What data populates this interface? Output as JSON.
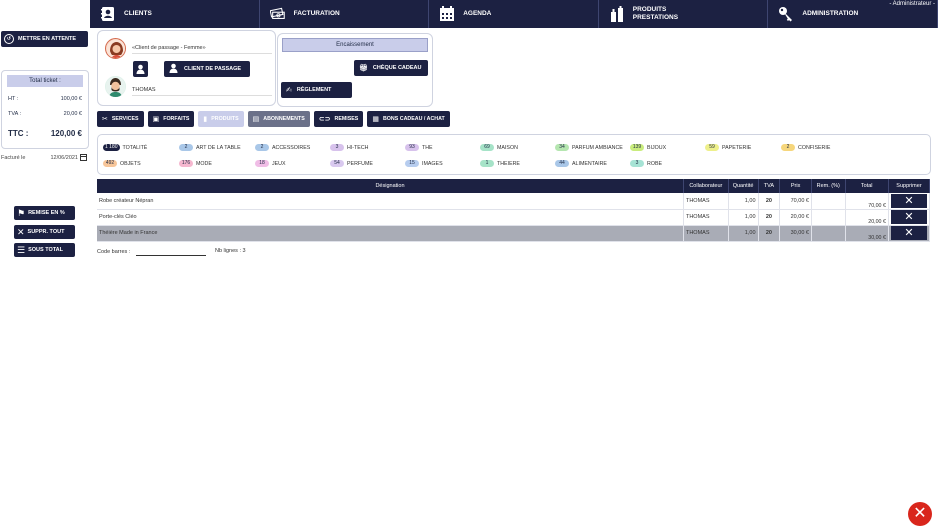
{
  "nav": {
    "items": [
      {
        "label": "CLIENTS",
        "icon": "address-book-icon"
      },
      {
        "label": "FACTURATION",
        "icon": "money-icon"
      },
      {
        "label": "AGENDA",
        "icon": "calendar-icon"
      },
      {
        "label": "PRODUITS\nPRESTATIONS",
        "line1": "PRODUITS",
        "line2": "PRESTATIONS",
        "icon": "bottles-icon"
      },
      {
        "label": "ADMINISTRATION",
        "icon": "key-icon"
      }
    ],
    "user": "- Administrateur -"
  },
  "left": {
    "wait_button": "METTRE EN ATTENTE",
    "ticket": {
      "title": "Total ticket :",
      "ht_label": "HT :",
      "ht_value": "100,00 €",
      "tva_label": "TVA :",
      "tva_value": "20,00 €",
      "ttc_label": "TTC :",
      "ttc_value": "120,00 €"
    },
    "invoice_label": "Facturé le",
    "invoice_date": "12/06/2021",
    "remise_button": "REMISE EN %",
    "suppr_button": "SUPPR. TOUT",
    "soustotal_button": "SOUS TOTAL"
  },
  "client": {
    "name": "«Client de passage - Femme»",
    "passage_button": "CLIENT DE PASSAGE",
    "collaborator": "THOMAS"
  },
  "encaissement": {
    "title": "Encaissement",
    "cheque_button": "CHÈQUE CADEAU",
    "reglement_button": "RÈGLEMENT"
  },
  "tabs": [
    {
      "label": "SERVICES",
      "style": "dark"
    },
    {
      "label": "FORFAITS",
      "style": "dark"
    },
    {
      "label": "PRODUITS",
      "style": "light"
    },
    {
      "label": "ABONNEMENTS",
      "style": "mid"
    },
    {
      "label": "REMISES",
      "style": "dark"
    },
    {
      "label": "BONS CADEAU / ACHAT",
      "style": "dark"
    }
  ],
  "filters": [
    {
      "count": "1 180",
      "label": "TOTALITÉ",
      "color": "#1c2142",
      "text": "#ffffff"
    },
    {
      "count": "2",
      "label": "ART DE LA TABLE",
      "color": "#a9c7e8",
      "text": "#1f2a44"
    },
    {
      "count": "2",
      "label": "ACCESSOIRES",
      "color": "#a9c7e8",
      "text": "#1f2a44"
    },
    {
      "count": "3",
      "label": "HI-TECH",
      "color": "#d7c2ec",
      "text": "#1f2a44"
    },
    {
      "count": "93",
      "label": "THE",
      "color": "#d7c2ec",
      "text": "#1f2a44"
    },
    {
      "count": "69",
      "label": "MAISON",
      "color": "#a6e3c8",
      "text": "#1f2a44"
    },
    {
      "count": "34",
      "label": "PARFUM AMBIANCE",
      "color": "#b5e6b0",
      "text": "#1f2a44"
    },
    {
      "count": "139",
      "label": "BIJOUX",
      "color": "#c9ec7d",
      "text": "#1f2a44"
    },
    {
      "count": "59",
      "label": "PAPETERIE",
      "color": "#eef08b",
      "text": "#1f2a44"
    },
    {
      "count": "2",
      "label": "CONFISERIE",
      "color": "#f6d67c",
      "text": "#1f2a44"
    },
    {
      "count": "492",
      "label": "OBJETS",
      "color": "#f7c69a",
      "text": "#1f2a44"
    },
    {
      "count": "176",
      "label": "MODE",
      "color": "#f5b7cf",
      "text": "#1f2a44"
    },
    {
      "count": "18",
      "label": "JEUX",
      "color": "#f0bde6",
      "text": "#1f2a44"
    },
    {
      "count": "54",
      "label": "PERFUME",
      "color": "#d9c9ef",
      "text": "#1f2a44"
    },
    {
      "count": "15",
      "label": "IMAGES",
      "color": "#b7cdef",
      "text": "#1f2a44"
    },
    {
      "count": "1",
      "label": "THEIERE",
      "color": "#a6e3c8",
      "text": "#1f2a44"
    },
    {
      "count": "44",
      "label": "ALIMENTAIRE",
      "color": "#a9c7e8",
      "text": "#1f2a44"
    },
    {
      "count": "3",
      "label": "ROBE",
      "color": "#a6e3d5",
      "text": "#1f2a44"
    }
  ],
  "table": {
    "headers": [
      "Désignation",
      "Collaborateur",
      "Quantité",
      "TVA",
      "Prix",
      "Rem. (%)",
      "Total",
      "Supprimer"
    ],
    "rows": [
      {
        "designation": "Robe créateur Népran",
        "collab": "THOMAS",
        "qty": "1,00",
        "tva": "20",
        "prix": "70,00 €",
        "rem": "",
        "total": "70,00 €"
      },
      {
        "designation": "Porte-clés Cléo",
        "collab": "THOMAS",
        "qty": "1,00",
        "tva": "20",
        "prix": "20,00 €",
        "rem": "",
        "total": "20,00 €"
      },
      {
        "designation": "Théière Made in France",
        "collab": "THOMAS",
        "qty": "1,00",
        "tva": "20",
        "prix": "30,00 €",
        "rem": "",
        "total": "30,00 €"
      }
    ],
    "delete_glyph": "✕"
  },
  "footer": {
    "barcode_label": "Code barres :",
    "lines_label": "Nb lignes : 3"
  },
  "close_glyph": "✕"
}
